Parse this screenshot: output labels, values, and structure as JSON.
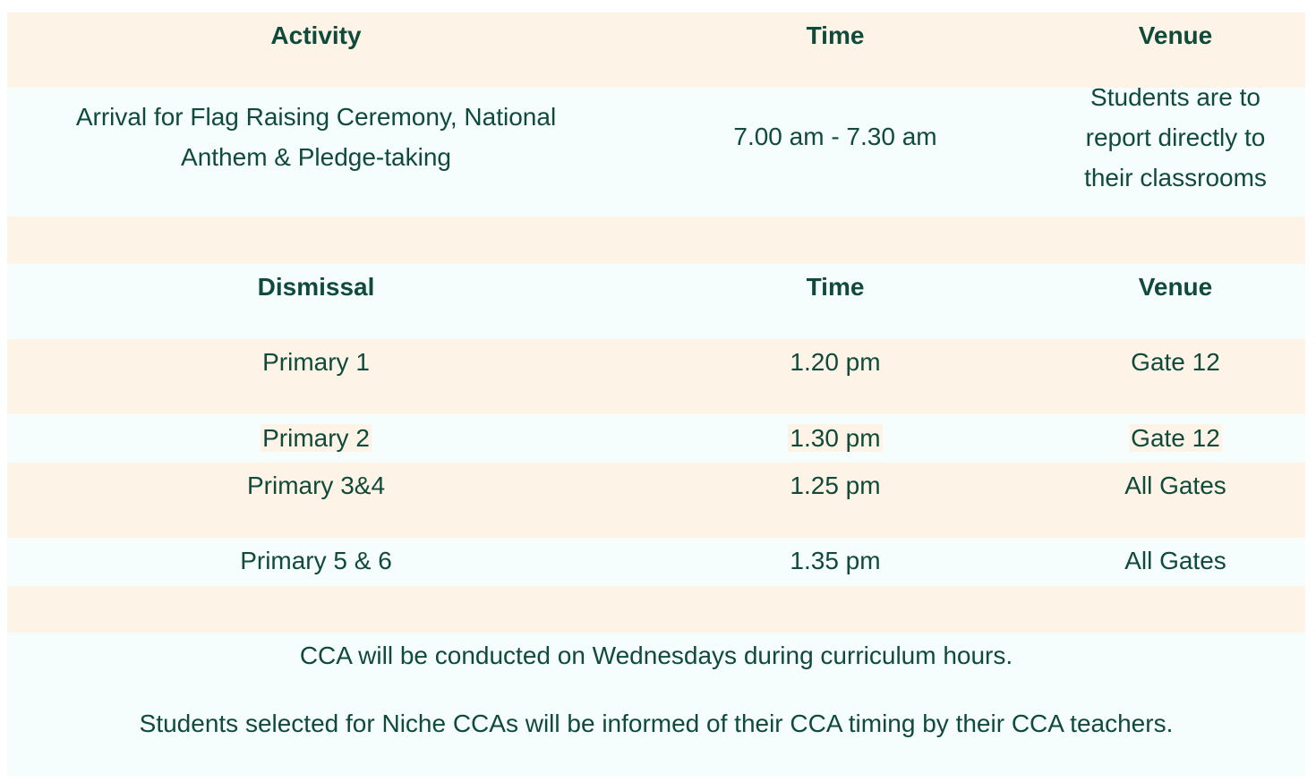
{
  "arrival_table": {
    "headers": {
      "activity": "Activity",
      "time": "Time",
      "venue": "Venue"
    },
    "row": {
      "activity_line1": "Arrival for Flag Raising Ceremony, National",
      "activity_line2": "Anthem & Pledge-taking",
      "time": "7.00 am - 7.30 am",
      "venue_line1": "Students are to",
      "venue_line2": "report directly to",
      "venue_line3": "their classrooms"
    }
  },
  "dismissal_table": {
    "headers": {
      "dismissal": "Dismissal",
      "time": "Time",
      "venue": "Venue"
    },
    "rows": [
      {
        "level": "Primary 1",
        "time": "1.20 pm",
        "venue": "Gate 12"
      },
      {
        "level": "Primary  2",
        "time": "1.30 pm",
        "venue": "Gate 12"
      },
      {
        "level": "Primary 3&4",
        "time": "1.25 pm",
        "venue": "All Gates"
      },
      {
        "level": "Primary 5 & 6",
        "time": "1.35 pm",
        "venue": "All Gates"
      }
    ]
  },
  "notes": {
    "cca_line1": "CCA will be conducted on Wednesdays during curriculum hours.",
    "cca_line2": "Students selected for Niche CCAs will be informed of their CCA timing by their CCA teachers."
  },
  "colors": {
    "peach": "#fdf4e7",
    "mint": "#f5fefd",
    "text": "#0f4a3a"
  }
}
